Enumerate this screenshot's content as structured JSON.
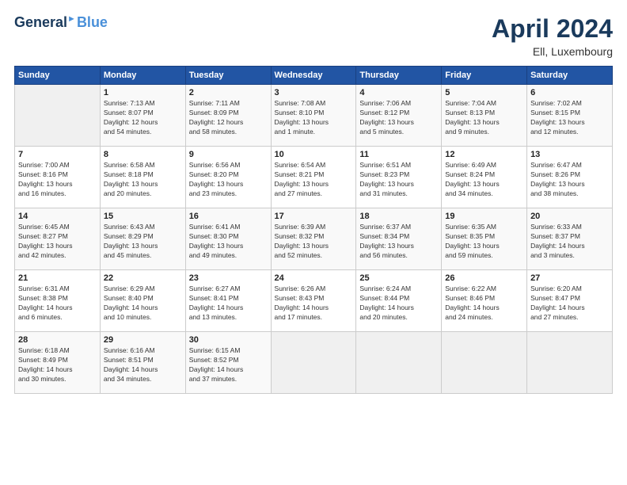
{
  "header": {
    "logo_line1": "General",
    "logo_line2": "Blue",
    "month": "April 2024",
    "location": "Ell, Luxembourg"
  },
  "weekdays": [
    "Sunday",
    "Monday",
    "Tuesday",
    "Wednesday",
    "Thursday",
    "Friday",
    "Saturday"
  ],
  "weeks": [
    [
      {
        "day": "",
        "info": ""
      },
      {
        "day": "1",
        "info": "Sunrise: 7:13 AM\nSunset: 8:07 PM\nDaylight: 12 hours\nand 54 minutes."
      },
      {
        "day": "2",
        "info": "Sunrise: 7:11 AM\nSunset: 8:09 PM\nDaylight: 12 hours\nand 58 minutes."
      },
      {
        "day": "3",
        "info": "Sunrise: 7:08 AM\nSunset: 8:10 PM\nDaylight: 13 hours\nand 1 minute."
      },
      {
        "day": "4",
        "info": "Sunrise: 7:06 AM\nSunset: 8:12 PM\nDaylight: 13 hours\nand 5 minutes."
      },
      {
        "day": "5",
        "info": "Sunrise: 7:04 AM\nSunset: 8:13 PM\nDaylight: 13 hours\nand 9 minutes."
      },
      {
        "day": "6",
        "info": "Sunrise: 7:02 AM\nSunset: 8:15 PM\nDaylight: 13 hours\nand 12 minutes."
      }
    ],
    [
      {
        "day": "7",
        "info": "Sunrise: 7:00 AM\nSunset: 8:16 PM\nDaylight: 13 hours\nand 16 minutes."
      },
      {
        "day": "8",
        "info": "Sunrise: 6:58 AM\nSunset: 8:18 PM\nDaylight: 13 hours\nand 20 minutes."
      },
      {
        "day": "9",
        "info": "Sunrise: 6:56 AM\nSunset: 8:20 PM\nDaylight: 13 hours\nand 23 minutes."
      },
      {
        "day": "10",
        "info": "Sunrise: 6:54 AM\nSunset: 8:21 PM\nDaylight: 13 hours\nand 27 minutes."
      },
      {
        "day": "11",
        "info": "Sunrise: 6:51 AM\nSunset: 8:23 PM\nDaylight: 13 hours\nand 31 minutes."
      },
      {
        "day": "12",
        "info": "Sunrise: 6:49 AM\nSunset: 8:24 PM\nDaylight: 13 hours\nand 34 minutes."
      },
      {
        "day": "13",
        "info": "Sunrise: 6:47 AM\nSunset: 8:26 PM\nDaylight: 13 hours\nand 38 minutes."
      }
    ],
    [
      {
        "day": "14",
        "info": "Sunrise: 6:45 AM\nSunset: 8:27 PM\nDaylight: 13 hours\nand 42 minutes."
      },
      {
        "day": "15",
        "info": "Sunrise: 6:43 AM\nSunset: 8:29 PM\nDaylight: 13 hours\nand 45 minutes."
      },
      {
        "day": "16",
        "info": "Sunrise: 6:41 AM\nSunset: 8:30 PM\nDaylight: 13 hours\nand 49 minutes."
      },
      {
        "day": "17",
        "info": "Sunrise: 6:39 AM\nSunset: 8:32 PM\nDaylight: 13 hours\nand 52 minutes."
      },
      {
        "day": "18",
        "info": "Sunrise: 6:37 AM\nSunset: 8:34 PM\nDaylight: 13 hours\nand 56 minutes."
      },
      {
        "day": "19",
        "info": "Sunrise: 6:35 AM\nSunset: 8:35 PM\nDaylight: 13 hours\nand 59 minutes."
      },
      {
        "day": "20",
        "info": "Sunrise: 6:33 AM\nSunset: 8:37 PM\nDaylight: 14 hours\nand 3 minutes."
      }
    ],
    [
      {
        "day": "21",
        "info": "Sunrise: 6:31 AM\nSunset: 8:38 PM\nDaylight: 14 hours\nand 6 minutes."
      },
      {
        "day": "22",
        "info": "Sunrise: 6:29 AM\nSunset: 8:40 PM\nDaylight: 14 hours\nand 10 minutes."
      },
      {
        "day": "23",
        "info": "Sunrise: 6:27 AM\nSunset: 8:41 PM\nDaylight: 14 hours\nand 13 minutes."
      },
      {
        "day": "24",
        "info": "Sunrise: 6:26 AM\nSunset: 8:43 PM\nDaylight: 14 hours\nand 17 minutes."
      },
      {
        "day": "25",
        "info": "Sunrise: 6:24 AM\nSunset: 8:44 PM\nDaylight: 14 hours\nand 20 minutes."
      },
      {
        "day": "26",
        "info": "Sunrise: 6:22 AM\nSunset: 8:46 PM\nDaylight: 14 hours\nand 24 minutes."
      },
      {
        "day": "27",
        "info": "Sunrise: 6:20 AM\nSunset: 8:47 PM\nDaylight: 14 hours\nand 27 minutes."
      }
    ],
    [
      {
        "day": "28",
        "info": "Sunrise: 6:18 AM\nSunset: 8:49 PM\nDaylight: 14 hours\nand 30 minutes."
      },
      {
        "day": "29",
        "info": "Sunrise: 6:16 AM\nSunset: 8:51 PM\nDaylight: 14 hours\nand 34 minutes."
      },
      {
        "day": "30",
        "info": "Sunrise: 6:15 AM\nSunset: 8:52 PM\nDaylight: 14 hours\nand 37 minutes."
      },
      {
        "day": "",
        "info": ""
      },
      {
        "day": "",
        "info": ""
      },
      {
        "day": "",
        "info": ""
      },
      {
        "day": "",
        "info": ""
      }
    ]
  ]
}
